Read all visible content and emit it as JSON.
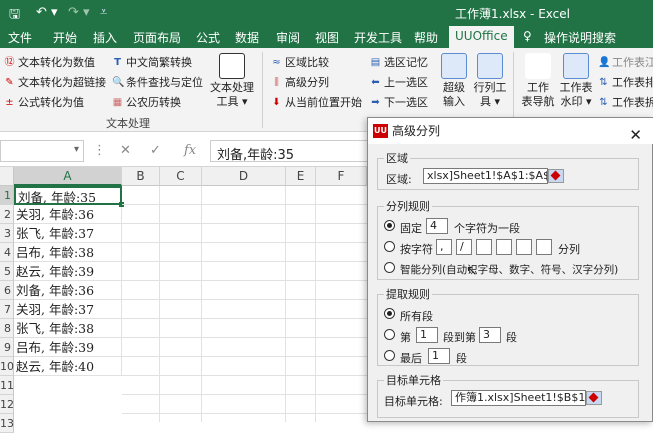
{
  "titlebar": {
    "title": "工作薄1.xlsx - Excel",
    "save_icon": "save-icon",
    "undo_icon": "undo-icon",
    "redo_icon": "redo-icon"
  },
  "tabs": [
    "文件",
    "开始",
    "插入",
    "页面布局",
    "公式",
    "数据",
    "审阅",
    "视图",
    "开发工具",
    "帮助",
    "UUOffice",
    "操作说明搜索"
  ],
  "ribbon": {
    "text_group": {
      "items": [
        "文本转化为数值",
        "文本转化为超链接",
        "公式转化为值",
        "中文简繁转换",
        "条件查找与定位",
        "公农历转换"
      ],
      "big_button": "文本处理",
      "big_button_sub": "工具 ▾",
      "group_label": "文本处理"
    },
    "split_group": {
      "items": [
        "区域比较",
        "高级分列",
        "从当前位置开始",
        "选区记忆",
        "上一选区",
        "下一选区"
      ],
      "big1": "超级",
      "big1_sub": "输入",
      "big2": "行列工",
      "big2_sub": "具 ▾"
    },
    "nav_group": {
      "big1": "工作",
      "big1_sub": "表导航",
      "big2": "工作表",
      "big2_sub": "水印 ▾",
      "items": [
        "工作表江",
        "工作表排",
        "工作表拆"
      ]
    }
  },
  "formula_bar": {
    "fx": "fx",
    "value": "刘备,年龄:35"
  },
  "sheet": {
    "columns": [
      "A",
      "B",
      "C",
      "D",
      "E",
      "F"
    ],
    "rows": [
      "1",
      "2",
      "3",
      "4",
      "5",
      "6",
      "7",
      "8",
      "9",
      "10",
      "11",
      "12",
      "13",
      "14"
    ],
    "cells": [
      "刘备, 年龄:35",
      "关羽, 年龄:36",
      "张飞, 年龄:37",
      "吕布, 年龄:38",
      "赵云, 年龄:39",
      "刘备, 年龄:36",
      "关羽, 年龄:37",
      "张飞, 年龄:38",
      "吕布, 年龄:39",
      "赵云, 年龄:40"
    ]
  },
  "dialog": {
    "title": "高级分列",
    "logo": "UU",
    "region": {
      "legend": "区域",
      "label": "区域:",
      "value": "xlsx]Sheet1!$A$1:$A$10"
    },
    "rule": {
      "legend": "分列规则",
      "fixed_label": "固定",
      "fixed_value": "4",
      "fixed_suffix": "个字符为一段",
      "char_label": "按字符",
      "char_values": [
        ",",
        "/",
        "",
        "",
        "",
        ""
      ],
      "char_suffix": "分列",
      "smart_label": "智能分列(自动识字母、数字、符号、汉字分列)"
    },
    "extract": {
      "legend": "提取规则",
      "all_label": "所有段",
      "range_prefix": "第",
      "range_from": "1",
      "range_mid": "段到第",
      "range_to": "3",
      "range_suffix": "段",
      "last_prefix": "最后",
      "last_value": "1",
      "last_suffix": "段"
    },
    "target": {
      "legend": "目标单元格",
      "label": "目标单元格:",
      "value": "作簿1.xlsx]Sheet1!$B$1"
    }
  }
}
